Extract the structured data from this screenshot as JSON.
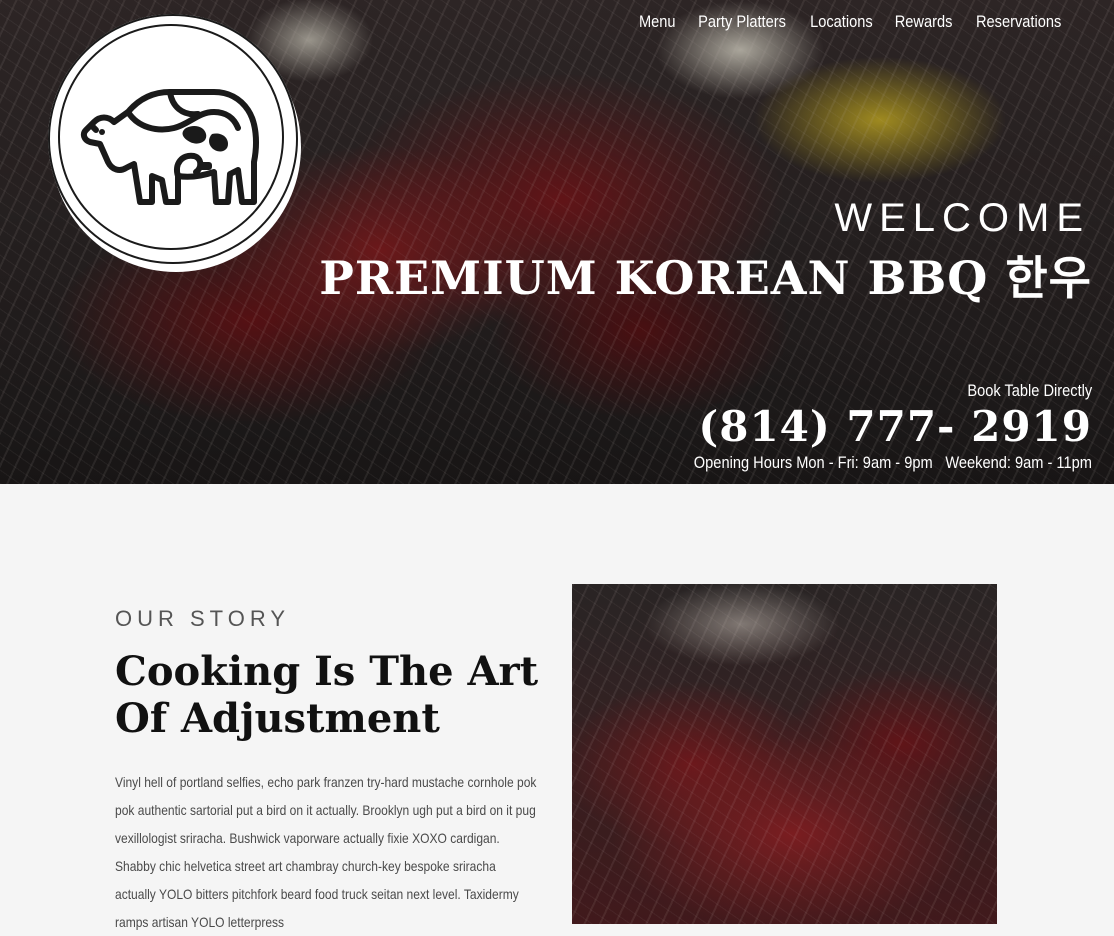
{
  "nav": {
    "items": [
      {
        "label": "Menu"
      },
      {
        "label": "Party Platters"
      },
      {
        "label": "Locations"
      },
      {
        "label": "Rewards"
      },
      {
        "label": "Reservations"
      }
    ]
  },
  "logo": {
    "icon": "cow-icon"
  },
  "hero": {
    "welcome": "WELCOME",
    "title": "PREMIUM KOREAN BBQ 한우",
    "book_label": "Book Table Directly",
    "phone": "(814) 777- 2919",
    "hours_weekday": "Opening Hours Mon - Fri: 9am - 9pm",
    "hours_weekend": "Weekend: 9am - 11pm"
  },
  "story": {
    "label": "OUR STORY",
    "heading": "Cooking Is The Art Of Adjustment",
    "body": "Vinyl hell of portland selfies, echo park franzen try-hard mustache cornhole pok pok authentic sartorial put a bird on it actually. Brooklyn ugh put a bird on it pug vexillologist sriracha. Bushwick vaporware actually fixie XOXO cardigan. Shabby chic helvetica street art chambray church-key bespoke sriracha actually YOLO bitters pitchfork beard food truck seitan next level. Taxidermy ramps artisan YOLO letterpress"
  },
  "colors": {
    "text_light": "#ffffff",
    "heading_dark": "#111111",
    "page_bg": "#f5f5f5"
  }
}
